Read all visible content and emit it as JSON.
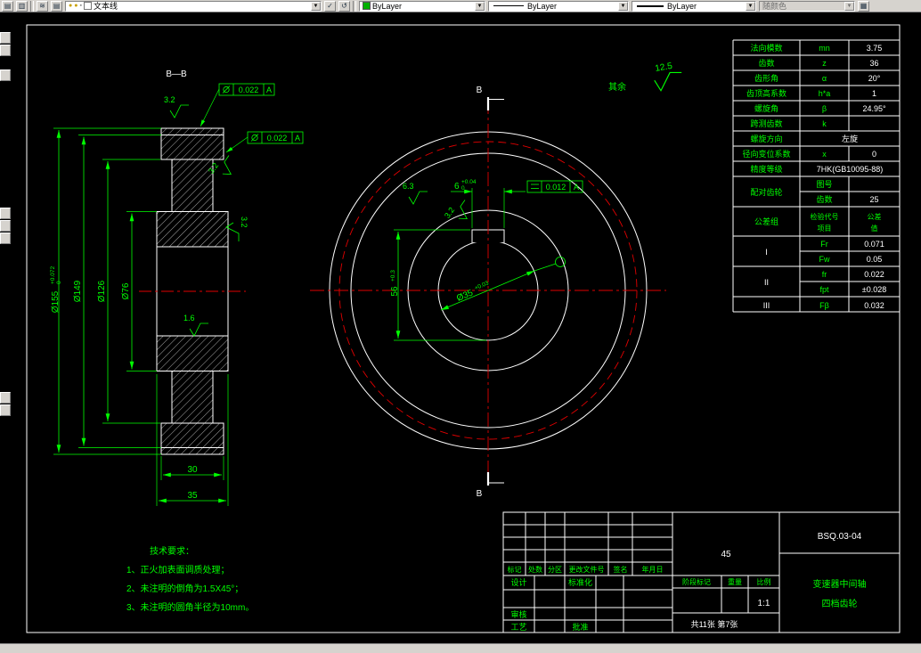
{
  "toolbar": {
    "layer_value": "文本线",
    "color_value": "ByLayer",
    "linetype_value": "ByLayer",
    "lineweight_value": "ByLayer",
    "plot_style_value": "随颜色"
  },
  "drawing": {
    "section_title": "B—B",
    "cut_label": "B",
    "default_roughness_prefix": "其余",
    "default_roughness_value": "12.5",
    "roughness": {
      "r_top": "3.2",
      "r_diag": "3.2",
      "r_side": "3.2",
      "r_web": "1.6",
      "r_hub": "6.3",
      "r_key": "3.2"
    },
    "dims": {
      "d155_main": "Ø155",
      "d155_tol_up": "+0.072",
      "d155_tol_dn": "0",
      "d149": "Ø149",
      "d126": "Ø126",
      "d76": "Ø76",
      "w30": "30",
      "w35": "35",
      "key_w_main": "6",
      "key_w_tol_up": "+0.04",
      "key_w_tol_dn": "0",
      "key_d_main": "56",
      "key_d_tol": "+0.3",
      "bore_main": "Ø35",
      "bore_tol": "+0.03"
    },
    "fcf": {
      "f1_val": "0.022",
      "f1_datum": "A",
      "f2_val": "0.022",
      "f2_datum": "A",
      "f3_val": "0.012",
      "f3_datum": "A"
    },
    "tech_req": {
      "title": "技术要求：",
      "item1": "1、正火加表面调质处理；",
      "item2": "2、未注明的倒角为1.5X45°；",
      "item3": "3、未注明的圆角半径为10mm。"
    }
  },
  "param_table": {
    "rows": [
      {
        "label": "法向模数",
        "sym": "mn",
        "val": "3.75"
      },
      {
        "label": "齿数",
        "sym": "z",
        "val": "36"
      },
      {
        "label": "齿形角",
        "sym": "α",
        "val": "20°"
      },
      {
        "label": "齿顶高系数",
        "sym": "h*a",
        "val": "1"
      },
      {
        "label": "螺旋角",
        "sym": "β",
        "val": "24.95°"
      },
      {
        "label": "跨测齿数",
        "sym": "k",
        "val": ""
      },
      {
        "label": "螺旋方向",
        "val": "左旋"
      },
      {
        "label": "径向变位系数",
        "sym": "x",
        "val": "0"
      },
      {
        "label": "精度等级",
        "val": "7HK(GB10095-88)"
      },
      {
        "label": "配对齿轮",
        "sym": "图号",
        "val": ""
      },
      {
        "sym": "齿数",
        "val": "25"
      }
    ],
    "tol_header": {
      "group": "公差组",
      "item_l1": "检验代号",
      "item_l2": "项目",
      "val_l1": "公差",
      "val_l2": "值"
    },
    "tol_rows": [
      {
        "group": "I",
        "sym": "Fr",
        "val": "0.071"
      },
      {
        "sym": "Fw",
        "val": "0.05"
      },
      {
        "group": "II",
        "sym": "fr",
        "val": "0.022"
      },
      {
        "sym": "fpt",
        "val": "±0.028"
      },
      {
        "group": "III",
        "sym": "Fβ",
        "val": "0.032"
      }
    ]
  },
  "title_block": {
    "material": "45",
    "drawing_no": "BSQ.03-04",
    "part_name_1": "变速器中间轴",
    "part_name_2": "四档齿轮",
    "scale": "1:1",
    "sheet_info": "共11张 第7张",
    "rev_headers": [
      "标记",
      "处数",
      "分区",
      "更改文件号",
      "签名",
      "年月日"
    ],
    "labels": {
      "design": "设计",
      "standardize": "标准化",
      "check": "审核",
      "process": "工艺",
      "approve": "批准",
      "stage": "阶段标记",
      "weight": "重量",
      "scale_label": "比例"
    }
  }
}
